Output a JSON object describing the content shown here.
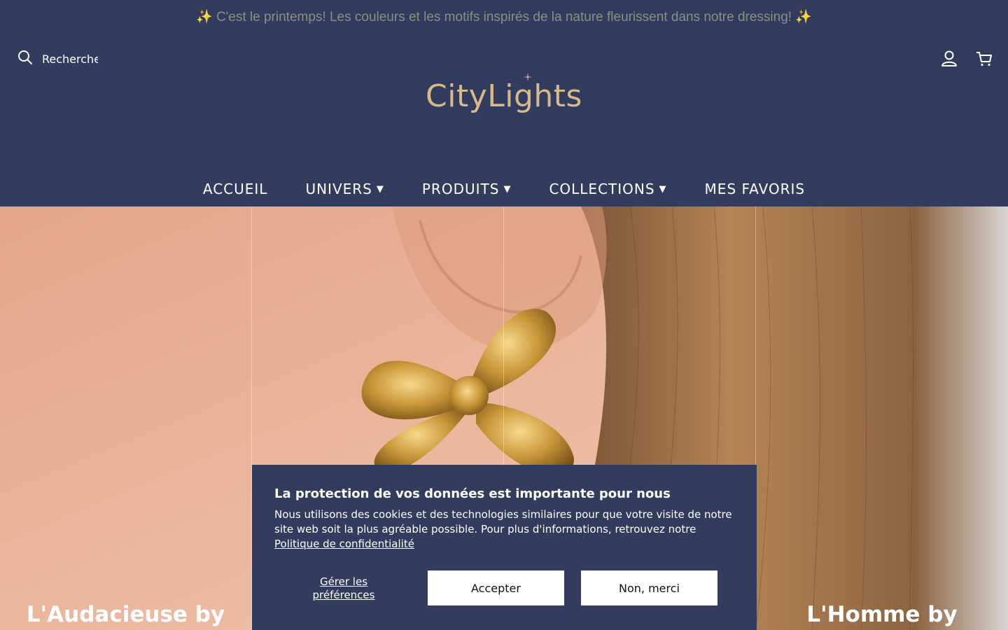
{
  "announcement": "✨ C'est le printemps! Les couleurs et les motifs inspirés de la nature fleurissent dans notre dressing! ✨",
  "search": {
    "placeholder": "Recherche"
  },
  "logo": {
    "text": "CityLights"
  },
  "nav": [
    {
      "label": "ACCUEIL",
      "has_dropdown": false
    },
    {
      "label": "UNIVERS",
      "has_dropdown": true
    },
    {
      "label": "PRODUITS",
      "has_dropdown": true
    },
    {
      "label": "COLLECTIONS",
      "has_dropdown": true
    },
    {
      "label": "MES FAVORIS",
      "has_dropdown": false
    }
  ],
  "hero": {
    "panels": [
      {
        "title": "L'Audacieuse by CityLights"
      },
      {
        "title": ""
      },
      {
        "title": ""
      },
      {
        "title": "L'Homme by CityLights"
      }
    ]
  },
  "cookie": {
    "title": "La protection de vos données est importante pour nous",
    "text": "Nous utilisons des cookies et des technologies similaires pour que votre visite de notre site web soit la plus agréable possible. Pour plus d'informations, retrouvez notre ",
    "link": "Politique de confidentialité",
    "manage": "Gérer les préférences",
    "accept": "Accepter",
    "decline": "Non, merci"
  },
  "colors": {
    "brand": "#323c5e",
    "gold": "#d7b98a",
    "announcement_text": "#8d8e83"
  },
  "icons": [
    "search-icon",
    "account-icon",
    "cart-icon",
    "caret-down-icon"
  ]
}
